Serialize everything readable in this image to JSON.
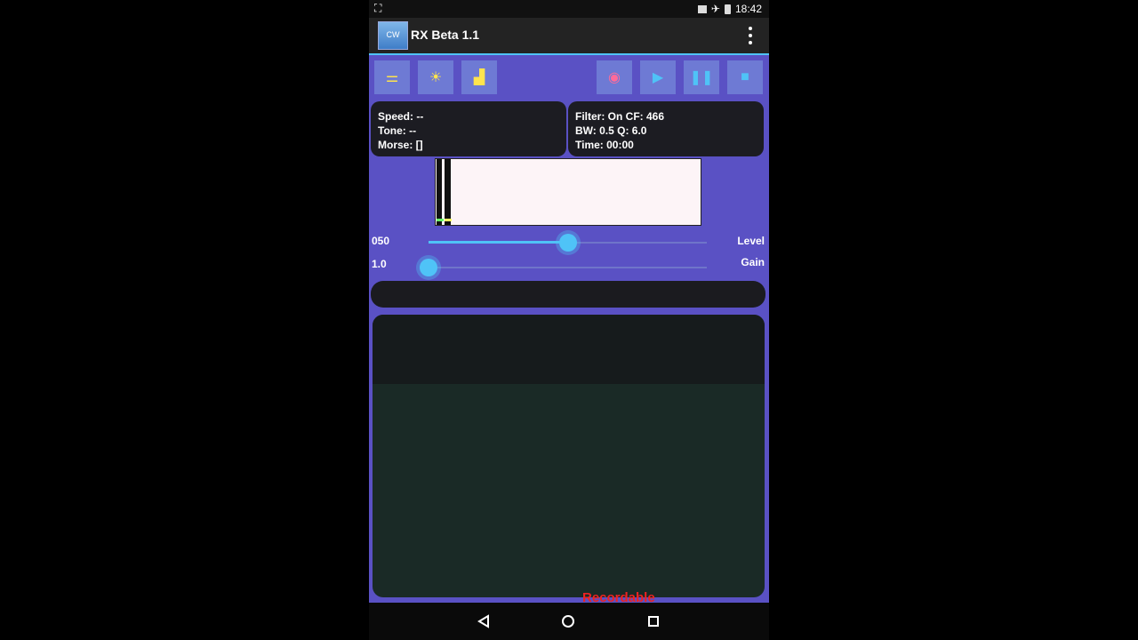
{
  "status": {
    "time": "18:42"
  },
  "app": {
    "title": "RX Beta 1.1",
    "icon_text": "CW"
  },
  "toolbar": {
    "left": [
      {
        "icon": "settings-sliders-icon",
        "glyph": "⚌",
        "color": "#ffe44d"
      },
      {
        "icon": "sun-icon",
        "glyph": "☀",
        "color": "#ffe44d"
      },
      {
        "icon": "bar-chart-icon",
        "glyph": "▟",
        "color": "#ffe44d"
      }
    ],
    "right": [
      {
        "icon": "record-icon",
        "glyph": "◉",
        "color": "#ff6b9a"
      },
      {
        "icon": "play-icon",
        "glyph": "▶",
        "color": "#4fc3f7"
      },
      {
        "icon": "pause-icon",
        "glyph": "❚❚",
        "color": "#4fc3f7"
      },
      {
        "icon": "stop-icon",
        "glyph": "■",
        "color": "#4fc3f7"
      }
    ]
  },
  "decoder": {
    "speed": "Speed: --",
    "tone": "Tone: --",
    "morse": "Morse: []"
  },
  "filter": {
    "line1": "Filter: On  CF: 466",
    "line2": "BW: 0.5  Q: 6.0",
    "line3": "Time: 00:00"
  },
  "sliders": {
    "level": {
      "value_text": "050",
      "label": "Level",
      "fraction": 0.5
    },
    "gain": {
      "value_text": "1.0",
      "label": "Gain",
      "fraction": 0.0
    }
  },
  "watermark": "Recordable",
  "colors": {
    "background": "#5a51c4",
    "accent": "#4fc3f7"
  }
}
